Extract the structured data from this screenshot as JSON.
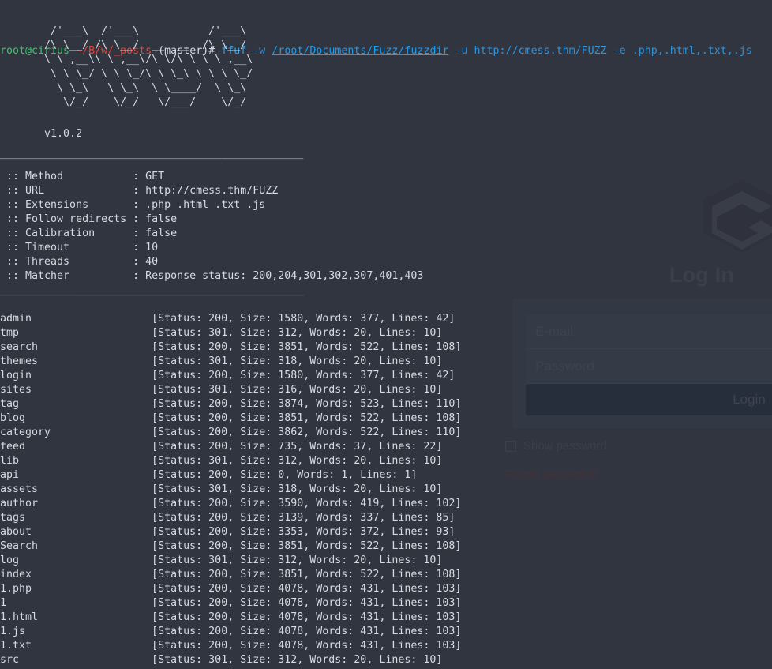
{
  "terminal": {
    "prompt": {
      "user_host": "root@cirius",
      "cwd": "~/B/w/_posts",
      "branch": "(master)#"
    },
    "command": {
      "name": "ffuf",
      "flag_w": "-w",
      "wordlist": "/root/Documents/Fuzz/fuzzdir",
      "flag_u": "-u",
      "url": "http://cmess.thm/FUZZ",
      "flag_e": "-e",
      "extensions": ".php,.html,.txt,.js"
    },
    "banner_ascii": "        /'___\\  /'___\\           /'___\\\n       /\\ \\__/ /\\ \\__/  __  __  /\\ \\__/\n       \\ \\ ,__\\\\ \\ ,__\\/\\ \\/\\ \\ \\ \\ ,__\\\n        \\ \\ \\_/ \\ \\ \\_/\\ \\ \\_\\ \\ \\ \\ \\_/\n         \\ \\_\\   \\ \\_\\  \\ \\____/  \\ \\_\\\n          \\/_/    \\/_/   \\/___/    \\/_/",
    "version": "       v1.0.2",
    "rule": "________________________________________________",
    "config_lines": [
      " :: Method           : GET",
      " :: URL              : http://cmess.thm/FUZZ",
      " :: Extensions       : .php .html .txt .js",
      " :: Follow redirects : false",
      " :: Calibration      : false",
      " :: Timeout          : 10",
      " :: Threads          : 40",
      " :: Matcher          : Response status: 200,204,301,302,307,401,403"
    ],
    "results": [
      {
        "path": "admin",
        "status": "200",
        "size": "1580",
        "words": "377",
        "lines": "42"
      },
      {
        "path": "tmp",
        "status": "301",
        "size": "312",
        "words": "20",
        "lines": "10"
      },
      {
        "path": "search",
        "status": "200",
        "size": "3851",
        "words": "522",
        "lines": "108"
      },
      {
        "path": "themes",
        "status": "301",
        "size": "318",
        "words": "20",
        "lines": "10"
      },
      {
        "path": "login",
        "status": "200",
        "size": "1580",
        "words": "377",
        "lines": "42"
      },
      {
        "path": "sites",
        "status": "301",
        "size": "316",
        "words": "20",
        "lines": "10"
      },
      {
        "path": "tag",
        "status": "200",
        "size": "3874",
        "words": "523",
        "lines": "110"
      },
      {
        "path": "blog",
        "status": "200",
        "size": "3851",
        "words": "522",
        "lines": "108"
      },
      {
        "path": "category",
        "status": "200",
        "size": "3862",
        "words": "522",
        "lines": "110"
      },
      {
        "path": "feed",
        "status": "200",
        "size": "735",
        "words": "37",
        "lines": "22"
      },
      {
        "path": "lib",
        "status": "301",
        "size": "312",
        "words": "20",
        "lines": "10"
      },
      {
        "path": "api",
        "status": "200",
        "size": "0",
        "words": "1",
        "lines": "1"
      },
      {
        "path": "assets",
        "status": "301",
        "size": "318",
        "words": "20",
        "lines": "10"
      },
      {
        "path": "author",
        "status": "200",
        "size": "3590",
        "words": "419",
        "lines": "102"
      },
      {
        "path": "tags",
        "status": "200",
        "size": "3139",
        "words": "337",
        "lines": "85"
      },
      {
        "path": "about",
        "status": "200",
        "size": "3353",
        "words": "372",
        "lines": "93"
      },
      {
        "path": "Search",
        "status": "200",
        "size": "3851",
        "words": "522",
        "lines": "108"
      },
      {
        "path": "log",
        "status": "301",
        "size": "312",
        "words": "20",
        "lines": "10"
      },
      {
        "path": "index",
        "status": "200",
        "size": "3851",
        "words": "522",
        "lines": "108"
      },
      {
        "path": "1.php",
        "status": "200",
        "size": "4078",
        "words": "431",
        "lines": "103"
      },
      {
        "path": "1",
        "status": "200",
        "size": "4078",
        "words": "431",
        "lines": "103"
      },
      {
        "path": "1.html",
        "status": "200",
        "size": "4078",
        "words": "431",
        "lines": "103"
      },
      {
        "path": "1.js",
        "status": "200",
        "size": "4078",
        "words": "431",
        "lines": "103"
      },
      {
        "path": "1.txt",
        "status": "200",
        "size": "4078",
        "words": "431",
        "lines": "103"
      },
      {
        "path": "src",
        "status": "301",
        "size": "312",
        "words": "20",
        "lines": "10"
      }
    ]
  },
  "background_page": {
    "logo_name": "hexagon-g-logo",
    "title": "Log In",
    "email_placeholder": "E-mail",
    "password_placeholder": "Password",
    "submit_label": "Login",
    "show_password_label": "Show password",
    "forgot_password_label": "Forgot password?"
  },
  "colors": {
    "terminal_bg": "#31353f",
    "prompt_user": "#3ec46d",
    "prompt_path": "#e2453c",
    "command_blue": "#2e93dd",
    "text": "#d7dae0",
    "login_button": "#262d3b"
  }
}
